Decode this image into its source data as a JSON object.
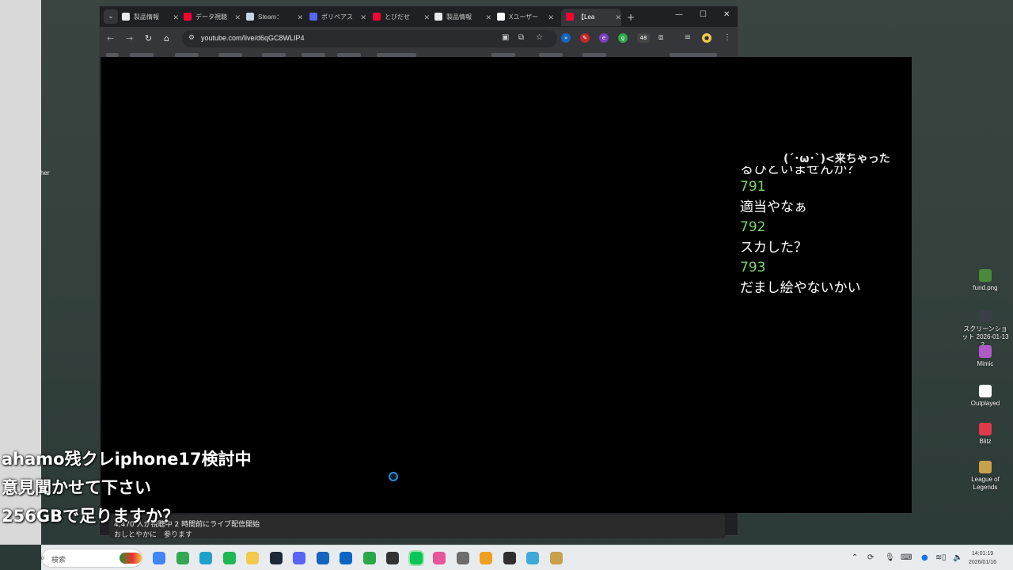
{
  "desktop": {
    "left_fragment": "her",
    "icons": [
      {
        "label": "fund.png",
        "color": "#4a8a3a"
      },
      {
        "label": "スクリーンショット 2026-01-13 2...",
        "color": "#3a3f45"
      },
      {
        "label": "Mimic",
        "color": "#b05ac8"
      },
      {
        "label": "Outplayed",
        "color": "#ffffff"
      },
      {
        "label": "Blitz",
        "color": "#e23a4a"
      },
      {
        "label": "League of Legends",
        "color": "#c8a24a"
      }
    ]
  },
  "browser": {
    "tabs": [
      {
        "label": "製品情報",
        "icon": "document-icon",
        "color": "#e8eaed"
      },
      {
        "label": "データ視聴",
        "icon": "youtube-icon",
        "color": "#ff0033"
      },
      {
        "label": "Steam：",
        "icon": "steam-icon",
        "color": "#c7d5e0"
      },
      {
        "label": "ポリペアス",
        "icon": "discord-icon",
        "color": "#5865f2"
      },
      {
        "label": "とびだせ",
        "icon": "youtube-icon",
        "color": "#ff0033"
      },
      {
        "label": "製品情報",
        "icon": "document-icon",
        "color": "#e8eaed"
      },
      {
        "label": "Xユーザー",
        "icon": "x-icon",
        "color": "#ffffff"
      },
      {
        "label": "【Lea",
        "icon": "youtube-icon",
        "color": "#ff0033",
        "active": true
      }
    ],
    "tab_list_glyph": "⌄",
    "new_tab_glyph": "+",
    "url": "youtube.com/live/d6qGC8WLIP4",
    "extension_badge": "48",
    "video_info": {
      "line1": "4,470 人が視聴中 2 時間前にライブ配信開始",
      "line2": "おしとやかに　参ります"
    }
  },
  "stream": {
    "kaomoji": "(´･ω･`)<来ちゃった",
    "chat": [
      {
        "type": "text",
        "text": "るひといませんか？",
        "clipped": true
      },
      {
        "type": "num",
        "text": "791"
      },
      {
        "type": "text",
        "text": "適当やなぁ"
      },
      {
        "type": "num",
        "text": "792"
      },
      {
        "type": "text",
        "text": "スカした？"
      },
      {
        "type": "num",
        "text": "793"
      },
      {
        "type": "text",
        "text": "だまし絵やないかい"
      }
    ],
    "caption_lines": [
      "ahamo残クレiphone17検討中",
      "意見聞かせて下さい",
      "256GBで足りますか？"
    ]
  },
  "taskbar": {
    "search_placeholder": "検索",
    "apps": [
      {
        "name": "chrome-icon",
        "color": "#4285f4"
      },
      {
        "name": "chrome-alt-icon",
        "color": "#34a853"
      },
      {
        "name": "edge-icon",
        "color": "#1fa1c9"
      },
      {
        "name": "spotify-icon",
        "color": "#1db954"
      },
      {
        "name": "file-explorer-icon",
        "color": "#f2c94c"
      },
      {
        "name": "steam-icon",
        "color": "#1b2838"
      },
      {
        "name": "discord-icon",
        "color": "#5865f2"
      },
      {
        "name": "u-app-icon",
        "color": "#1565c0"
      },
      {
        "name": "photos-icon",
        "color": "#0a66c2"
      },
      {
        "name": "checkmark-app-icon",
        "color": "#2ba84a"
      },
      {
        "name": "cursor-app-icon",
        "color": "#333333"
      },
      {
        "name": "line-icon",
        "color": "#06c755"
      },
      {
        "name": "lips-app-icon",
        "color": "#e8559a"
      },
      {
        "name": "game-app-icon",
        "color": "#6d6d6d"
      },
      {
        "name": "coin-app-icon",
        "color": "#f0a020"
      },
      {
        "name": "obs-icon",
        "color": "#302e31"
      },
      {
        "name": "notes-app-icon",
        "color": "#3fa8d8"
      },
      {
        "name": "league-icon",
        "color": "#c8a24a"
      }
    ],
    "clock_time": "14:01:19",
    "clock_date": "2026/01/16"
  }
}
